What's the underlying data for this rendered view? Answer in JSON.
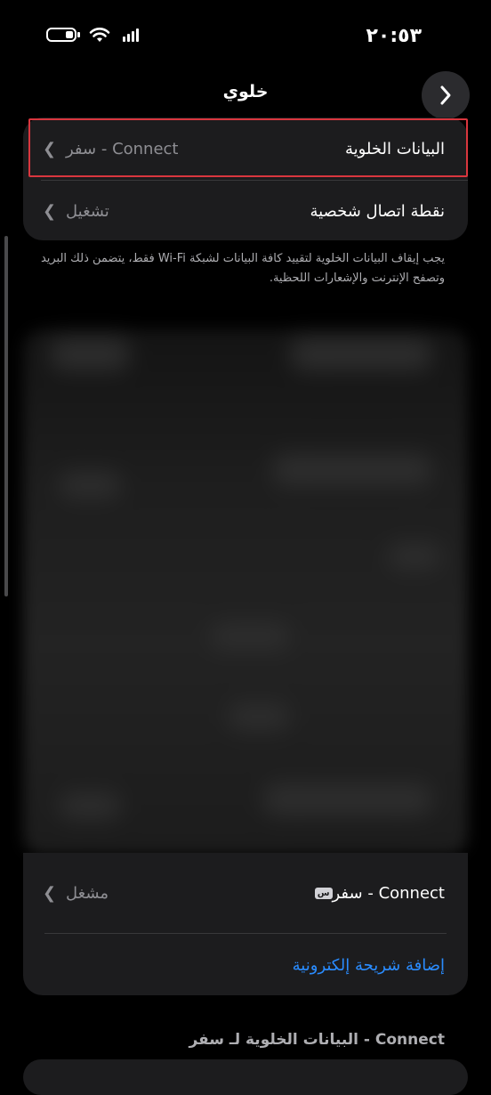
{
  "status_bar": {
    "time": "٢٠:٥٣"
  },
  "header": {
    "title": "خلوي",
    "back_icon": "chevron-right-icon"
  },
  "cellular_section": {
    "cellular_data": {
      "label": "البيانات الخلوية",
      "value": "سفر - Connect"
    },
    "hotspot": {
      "label": "نقطة اتصال شخصية",
      "value": "تشغيل"
    }
  },
  "note": "يجب إيقاف البيانات الخلوية لتقييد كافة البيانات لشبكة Wi-Fi فقط، يتضمن ذلك البريد وتصفح الإنترنت والإشعارات اللحظية.",
  "sim_section": {
    "sim_row": {
      "sim_badge": "س",
      "label": "سفر - Connect",
      "value": "مشغل"
    },
    "add_esim": "إضافة شريحة إلكترونية"
  },
  "section_footer": {
    "title": "البيانات الخلوية لـ سفر - Connect"
  },
  "colors": {
    "background": "#000000",
    "card": "#1c1c1e",
    "accent": "#2a8cff",
    "highlight": "#d9363e"
  }
}
